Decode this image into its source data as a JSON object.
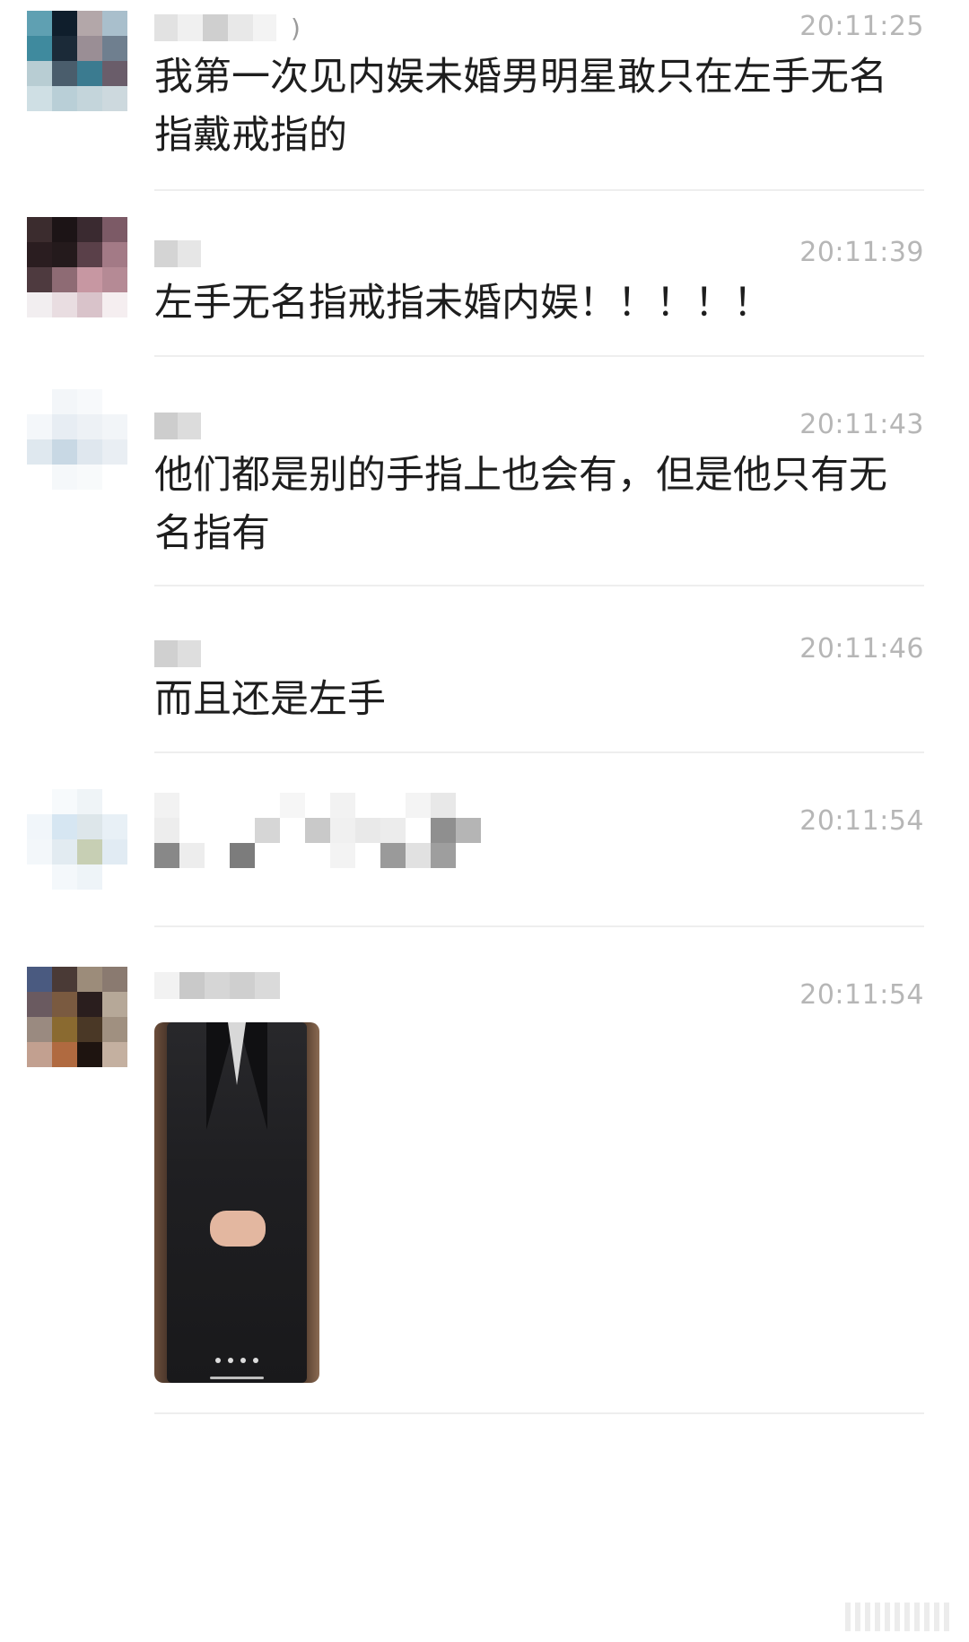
{
  "messages": [
    {
      "time": "20:11:25",
      "text": "我第一次见内娱未婚男明星敢只在左手无名指戴戒指的",
      "name_tail": ")"
    },
    {
      "time": "20:11:39",
      "text": "左手无名指戒指未婚内娱！！！！！"
    },
    {
      "time": "20:11:43",
      "text": "他们都是别的手指上也会有，但是他只有无名指有"
    },
    {
      "time": "20:11:46",
      "text": "而且还是左手"
    },
    {
      "time": "20:11:54",
      "text": ""
    },
    {
      "time": "20:11:54",
      "text": ""
    }
  ],
  "photo": {
    "icon": "photo-of-man-in-black-suit"
  }
}
